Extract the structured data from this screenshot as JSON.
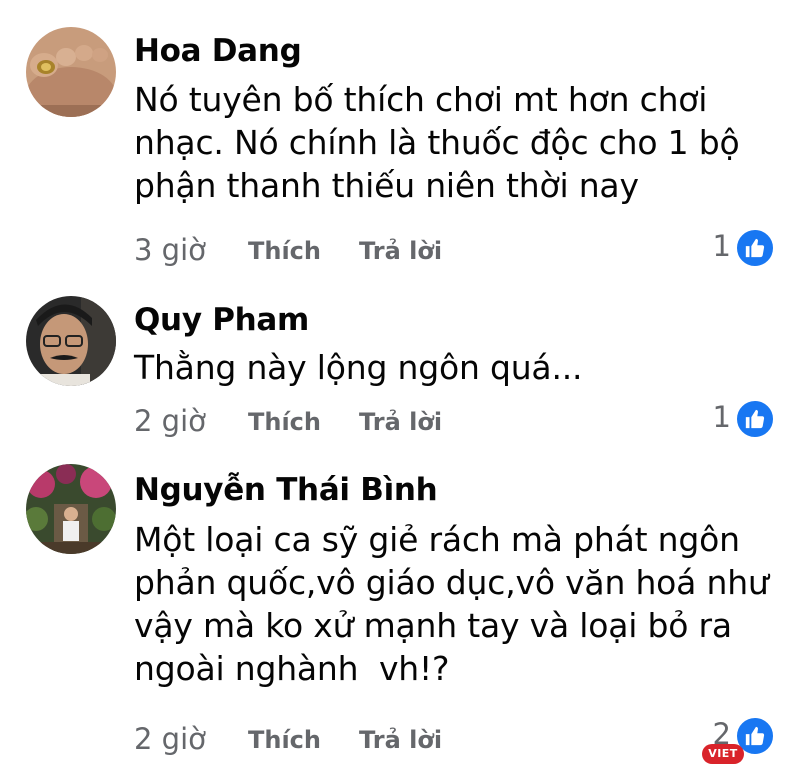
{
  "comments": [
    {
      "author": "Hoa Dang",
      "lines": [
        "Nó tuyên bố thích chơi mt hơn chơi",
        "nhạc. Nó chính là thuốc độc cho 1 bộ",
        "phận thanh thiếu niên thời nay"
      ],
      "time": "3 giờ",
      "like_label": "Thích",
      "reply_label": "Trả lời",
      "reaction_count": "1"
    },
    {
      "author": "Quy Pham",
      "lines": [
        "Thằng này lộng ngôn quá..."
      ],
      "time": "2 giờ",
      "like_label": "Thích",
      "reply_label": "Trả lời",
      "reaction_count": "1"
    },
    {
      "author": "Nguyễn Thái Bình",
      "lines": [
        "Một loại ca sỹ giẻ rách mà phát ngôn",
        "phản quốc,vô giáo dục,vô văn hoá như",
        "vậy mà ko xử mạnh tay và loại bỏ ra",
        "ngoài nghành  vh!?"
      ],
      "time": "2 giờ",
      "like_label": "Thích",
      "reply_label": "Trả lời",
      "reaction_count": "2"
    }
  ],
  "icons": {
    "reaction": "like-icon"
  },
  "watermark": "VIET",
  "colors": {
    "like_blue": "#1877f2",
    "meta_gray": "#65676b",
    "watermark_red": "#d9232a"
  }
}
